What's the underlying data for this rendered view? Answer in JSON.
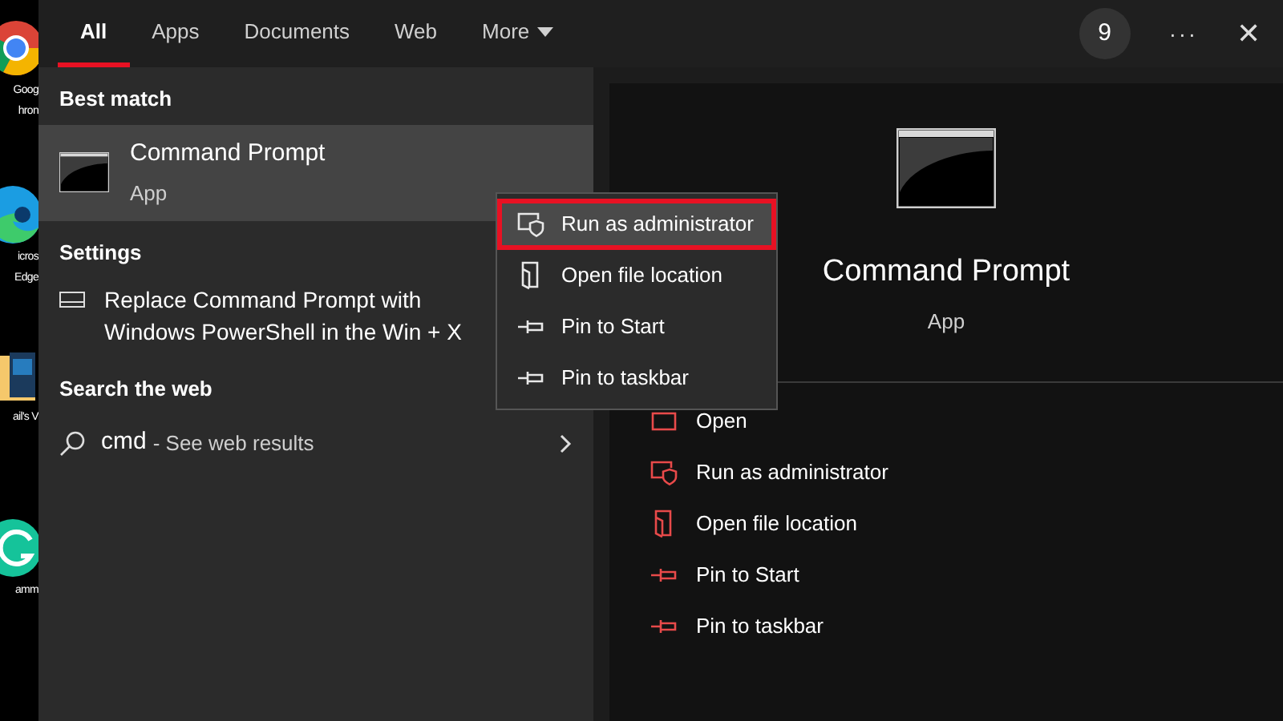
{
  "desktop_icons": [
    {
      "kind": "chrome",
      "labels": [
        "Goog",
        "hron"
      ]
    },
    {
      "kind": "edge",
      "labels": [
        "icros",
        "Edge"
      ]
    },
    {
      "kind": "folder",
      "labels": [
        "ail's V"
      ]
    },
    {
      "kind": "grammar",
      "labels": [
        "amm"
      ]
    }
  ],
  "tabs": [
    {
      "label": "All",
      "selected": true
    },
    {
      "label": "Apps",
      "selected": false
    },
    {
      "label": "Documents",
      "selected": false
    },
    {
      "label": "Web",
      "selected": false
    },
    {
      "label": "More",
      "selected": false,
      "dropdown": true
    }
  ],
  "top_right": {
    "badge": "9",
    "more": "···",
    "close": "✕"
  },
  "best_match": {
    "heading": "Best match",
    "title": "Command Prompt",
    "subtitle": "App",
    "selected": true
  },
  "settings": {
    "heading": "Settings",
    "items": [
      {
        "lines": [
          "Replace Command Prompt with",
          "Windows PowerShell in the Win + X"
        ]
      }
    ]
  },
  "web": {
    "heading": "Search the web",
    "query": "cmd",
    "suffix": "- See web results"
  },
  "context_menu": [
    {
      "kind": "shield",
      "label": "Run as administrator",
      "selected": true
    },
    {
      "kind": "folder",
      "label": "Open file location",
      "selected": false
    },
    {
      "kind": "pin",
      "label": "Pin to Start",
      "selected": false
    },
    {
      "kind": "pin",
      "label": "Pin to taskbar",
      "selected": false
    }
  ],
  "details": {
    "title": "Command Prompt",
    "subtitle": "App",
    "actions": [
      {
        "kind": "window",
        "label": "Open"
      },
      {
        "kind": "shield",
        "label": "Run as administrator"
      },
      {
        "kind": "folder",
        "label": "Open file location"
      },
      {
        "kind": "pin",
        "label": "Pin to Start"
      },
      {
        "kind": "pin",
        "label": "Pin to taskbar"
      }
    ]
  }
}
